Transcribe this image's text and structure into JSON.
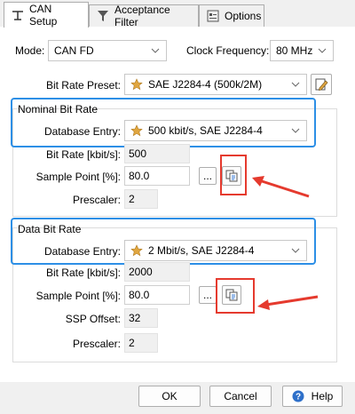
{
  "tabs": [
    {
      "label": "CAN Setup",
      "active": true
    },
    {
      "label": "Acceptance Filter",
      "active": false
    },
    {
      "label": "Options",
      "active": false
    }
  ],
  "mode": {
    "label": "Mode:",
    "value": "CAN FD"
  },
  "clock": {
    "label": "Clock Frequency:",
    "value": "80 MHz"
  },
  "preset": {
    "label": "Bit Rate Preset:",
    "value": "SAE J2284-4 (500k/2M)"
  },
  "nominal": {
    "title": "Nominal Bit Rate",
    "db_label": "Database Entry:",
    "db_value": "500 kbit/s, SAE J2284-4",
    "bitrate_label": "Bit Rate [kbit/s]:",
    "bitrate_value": "500",
    "sample_label": "Sample Point [%]:",
    "sample_value": "80.0",
    "ellipsis": "...",
    "prescaler_label": "Prescaler:",
    "prescaler_value": "2"
  },
  "data_rate": {
    "title": "Data Bit Rate",
    "db_label": "Database Entry:",
    "db_value": "2 Mbit/s, SAE J2284-4",
    "bitrate_label": "Bit Rate [kbit/s]:",
    "bitrate_value": "2000",
    "sample_label": "Sample Point [%]:",
    "sample_value": "80.0",
    "ellipsis": "...",
    "ssp_label": "SSP Offset:",
    "ssp_value": "32",
    "prescaler_label": "Prescaler:",
    "prescaler_value": "2"
  },
  "buttons": {
    "ok": "OK",
    "cancel": "Cancel",
    "help": "Help"
  },
  "colors": {
    "highlight": "#2d8fe6",
    "annotation": "#e53a2e",
    "star": "#e0a640"
  }
}
